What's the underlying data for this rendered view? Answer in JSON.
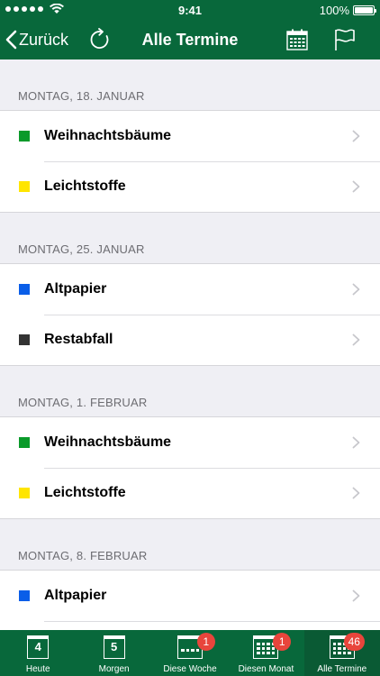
{
  "status_bar": {
    "time": "9:41",
    "battery": "100%"
  },
  "nav": {
    "back_label": "Zurück",
    "title": "Alle Termine"
  },
  "colors": {
    "brand": "#08683b",
    "green": "#0a9a2a",
    "yellow": "#ffe500",
    "blue": "#0a5ee8",
    "black": "#333333",
    "badge": "#e8453c"
  },
  "sections": [
    {
      "date": "MONTAG, 18. JANUAR",
      "items": [
        {
          "label": "Weihnachtsbäume",
          "color": "#0a9a2a"
        },
        {
          "label": "Leichtstoffe",
          "color": "#ffe500"
        }
      ]
    },
    {
      "date": "MONTAG, 25. JANUAR",
      "items": [
        {
          "label": "Altpapier",
          "color": "#0a5ee8"
        },
        {
          "label": "Restabfall",
          "color": "#333333"
        }
      ]
    },
    {
      "date": "MONTAG, 1. FEBRUAR",
      "items": [
        {
          "label": "Weihnachtsbäume",
          "color": "#0a9a2a"
        },
        {
          "label": "Leichtstoffe",
          "color": "#ffe500"
        }
      ]
    },
    {
      "date": "MONTAG, 8. FEBRUAR",
      "items": [
        {
          "label": "Altpapier",
          "color": "#0a5ee8"
        },
        {
          "label": "",
          "color": ""
        }
      ]
    }
  ],
  "tabs": [
    {
      "label": "Heute",
      "icon": "calendar-day-icon",
      "day": "4",
      "badge": ""
    },
    {
      "label": "Morgen",
      "icon": "calendar-day-icon",
      "day": "5",
      "badge": ""
    },
    {
      "label": "Diese Woche",
      "icon": "calendar-week-icon",
      "badge": "1"
    },
    {
      "label": "Diesen Monat",
      "icon": "calendar-month-icon",
      "badge": "1"
    },
    {
      "label": "Alle Termine",
      "icon": "calendar-all-icon",
      "badge": "46"
    }
  ]
}
